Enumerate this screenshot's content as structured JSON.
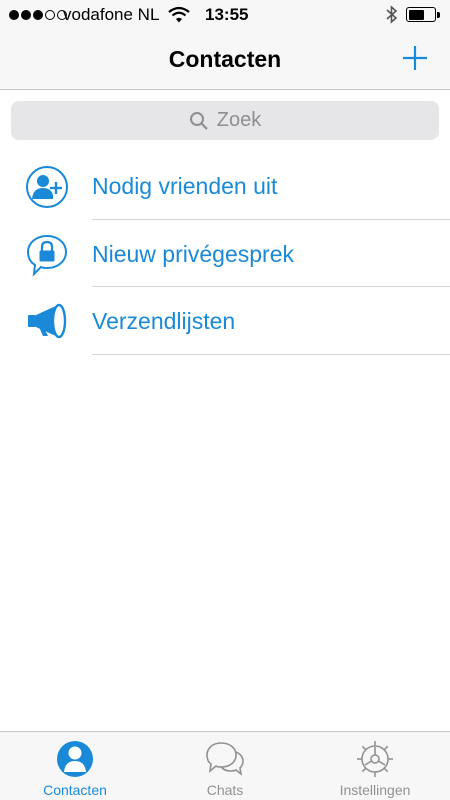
{
  "status_bar": {
    "carrier": "vodafone NL",
    "time": "13:55",
    "signal_bars_filled": 3,
    "signal_bars_total": 5,
    "battery_level": 0.62
  },
  "nav": {
    "title": "Contacten",
    "add_icon": "plus-icon"
  },
  "search": {
    "placeholder": "Zoek",
    "icon": "search-icon"
  },
  "list": {
    "items": [
      {
        "label": "Nodig vrienden uit",
        "icon": "add-contact-icon"
      },
      {
        "label": "Nieuw privégesprek",
        "icon": "lock-chat-icon"
      },
      {
        "label": "Verzendlijsten",
        "icon": "megaphone-icon"
      }
    ]
  },
  "tabbar": {
    "tabs": [
      {
        "label": "Contacten",
        "icon": "contacts-icon",
        "active": true
      },
      {
        "label": "Chats",
        "icon": "chats-icon",
        "active": false
      },
      {
        "label": "Instellingen",
        "icon": "gear-icon",
        "active": false
      }
    ]
  },
  "colors": {
    "accent": "#1a8ad8",
    "inactive": "#929292",
    "bar_background": "#f7f7f7",
    "search_background": "#e6e6e8"
  }
}
